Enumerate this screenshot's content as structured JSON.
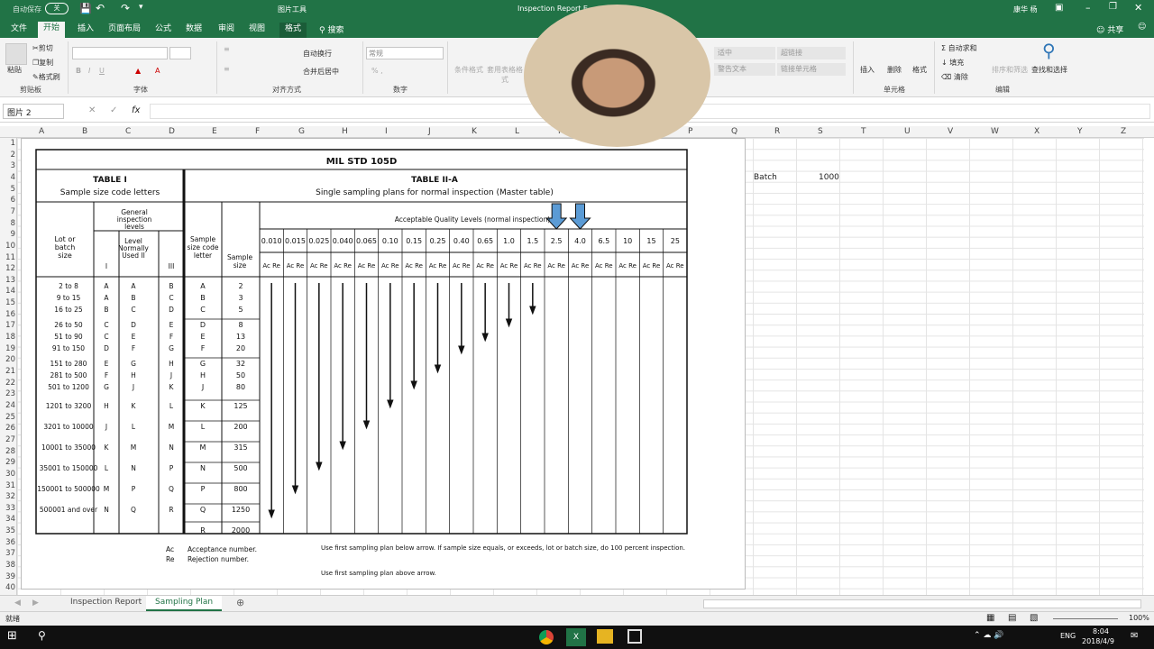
{
  "titlebar": {
    "autosave": "自动保存",
    "autosave_state": "关",
    "picture_tools": "图片工具",
    "title": "Inspection Report E...",
    "user": "康华 杨"
  },
  "tabs": [
    "文件",
    "开始",
    "插入",
    "页面布局",
    "公式",
    "数据",
    "审阅",
    "视图",
    "格式"
  ],
  "tell_me": "搜索",
  "share": "共享",
  "ribbon": {
    "clipboard": {
      "paste": "粘贴",
      "cut": "剪切",
      "copy": "复制",
      "format_painter": "格式刷",
      "label": "剪贴板"
    },
    "font": {
      "label": "字体"
    },
    "alignment": {
      "wrap": "自动换行",
      "merge": "合并后居中",
      "label": "对齐方式"
    },
    "number": {
      "format": "常规",
      "label": "数字"
    },
    "styles": {
      "conditional": "条件格式",
      "table": "套用表格格式",
      "good": "适中",
      "warning": "警告文本",
      "hyperlink": "超链接",
      "linked": "链接单元格"
    },
    "cells": {
      "insert": "插入",
      "delete": "删除",
      "format": "格式",
      "label": "单元格"
    },
    "editing": {
      "autosum": "自动求和",
      "fill": "填充",
      "clear": "清除",
      "sort": "排序和筛选",
      "find": "查找和选择",
      "label": "编辑"
    }
  },
  "formula": {
    "namebox": "图片 2",
    "content": ""
  },
  "columns": [
    "A",
    "B",
    "C",
    "D",
    "E",
    "F",
    "G",
    "H",
    "I",
    "J",
    "K",
    "L",
    "M",
    "N",
    "O",
    "P",
    "Q",
    "R",
    "S",
    "T",
    "U",
    "V",
    "W",
    "X",
    "Y",
    "Z"
  ],
  "rows": [
    "1",
    "2",
    "3",
    "4",
    "5",
    "6",
    "7",
    "8",
    "9",
    "10",
    "11",
    "12",
    "13",
    "14",
    "15",
    "16",
    "17",
    "18",
    "19",
    "20",
    "21",
    "22",
    "23",
    "24",
    "25",
    "26",
    "27",
    "28",
    "29",
    "30",
    "31",
    "32",
    "33",
    "34",
    "35",
    "36",
    "37",
    "38",
    "39",
    "40"
  ],
  "cells": {
    "batch_label": "Batch",
    "batch_value": "1000"
  },
  "image": {
    "title": "MIL STD 105D",
    "t1": "TABLE I",
    "t1sub": "Sample size code letters",
    "t2": "TABLE II-A",
    "t2sub": "Single sampling plans for normal inspection (Master table)",
    "aql_header": "Acceptable Quality Levels (normal inspection)",
    "gen_insp": "General inspection levels",
    "lot_col": "Lot or batch size",
    "level_cols": [
      "I",
      "Level Normally Used II",
      "III"
    ],
    "code_col": "Sample size code letter",
    "size_col": "Sample size",
    "aql": [
      "0.010",
      "0.015",
      "0.025",
      "0.040",
      "0.065",
      "0.10",
      "0.15",
      "0.25",
      "0.40",
      "0.65",
      "1.0",
      "1.5",
      "2.5",
      "4.0",
      "6.5",
      "10",
      "15",
      "25"
    ],
    "acre": "Ac Re",
    "lots": [
      "2 to 8",
      "9 to 15",
      "16 to 25",
      "26 to 50",
      "51 to 90",
      "91 to 150",
      "151 to 280",
      "281 to 500",
      "501 to 1200",
      "1201 to 3200",
      "3201 to 10000",
      "10001 to 35000",
      "35001 to 150000",
      "150001 to 500000",
      "500001 and over"
    ],
    "lvl1": [
      "A",
      "A",
      "B",
      "C",
      "C",
      "D",
      "E",
      "F",
      "G",
      "H",
      "J",
      "K",
      "L",
      "M",
      "N"
    ],
    "lvl2": [
      "A",
      "B",
      "C",
      "D",
      "E",
      "F",
      "G",
      "H",
      "J",
      "K",
      "L",
      "M",
      "N",
      "P",
      "Q"
    ],
    "lvl3": [
      "B",
      "C",
      "D",
      "E",
      "F",
      "G",
      "H",
      "J",
      "K",
      "L",
      "M",
      "N",
      "P",
      "Q",
      "R"
    ],
    "codes": [
      "A",
      "B",
      "C",
      "D",
      "E",
      "F",
      "G",
      "H",
      "J",
      "K",
      "L",
      "M",
      "N",
      "P",
      "Q",
      "R"
    ],
    "sizes": [
      "2",
      "3",
      "5",
      "8",
      "13",
      "20",
      "32",
      "50",
      "80",
      "125",
      "200",
      "315",
      "500",
      "800",
      "1250",
      "2000"
    ],
    "legend": {
      "ac": "Ac",
      "acd": "Acceptance number.",
      "re": "Re",
      "red": "Rejection number.",
      "down": "Use first sampling plan below arrow. If sample size equals, or exceeds, lot or batch size, do 100 percent inspection.",
      "up": "Use first sampling plan above arrow."
    }
  },
  "sheets": [
    "Inspection Report",
    "Sampling Plan"
  ],
  "status": {
    "ready": "就绪",
    "zoom": "100%"
  },
  "taskbar": {
    "lang": "ENG",
    "time": "8:04",
    "date": "2018/4/9"
  },
  "colors": {
    "excel_green": "#217346",
    "arrow_blue": "#5b9bd5"
  }
}
